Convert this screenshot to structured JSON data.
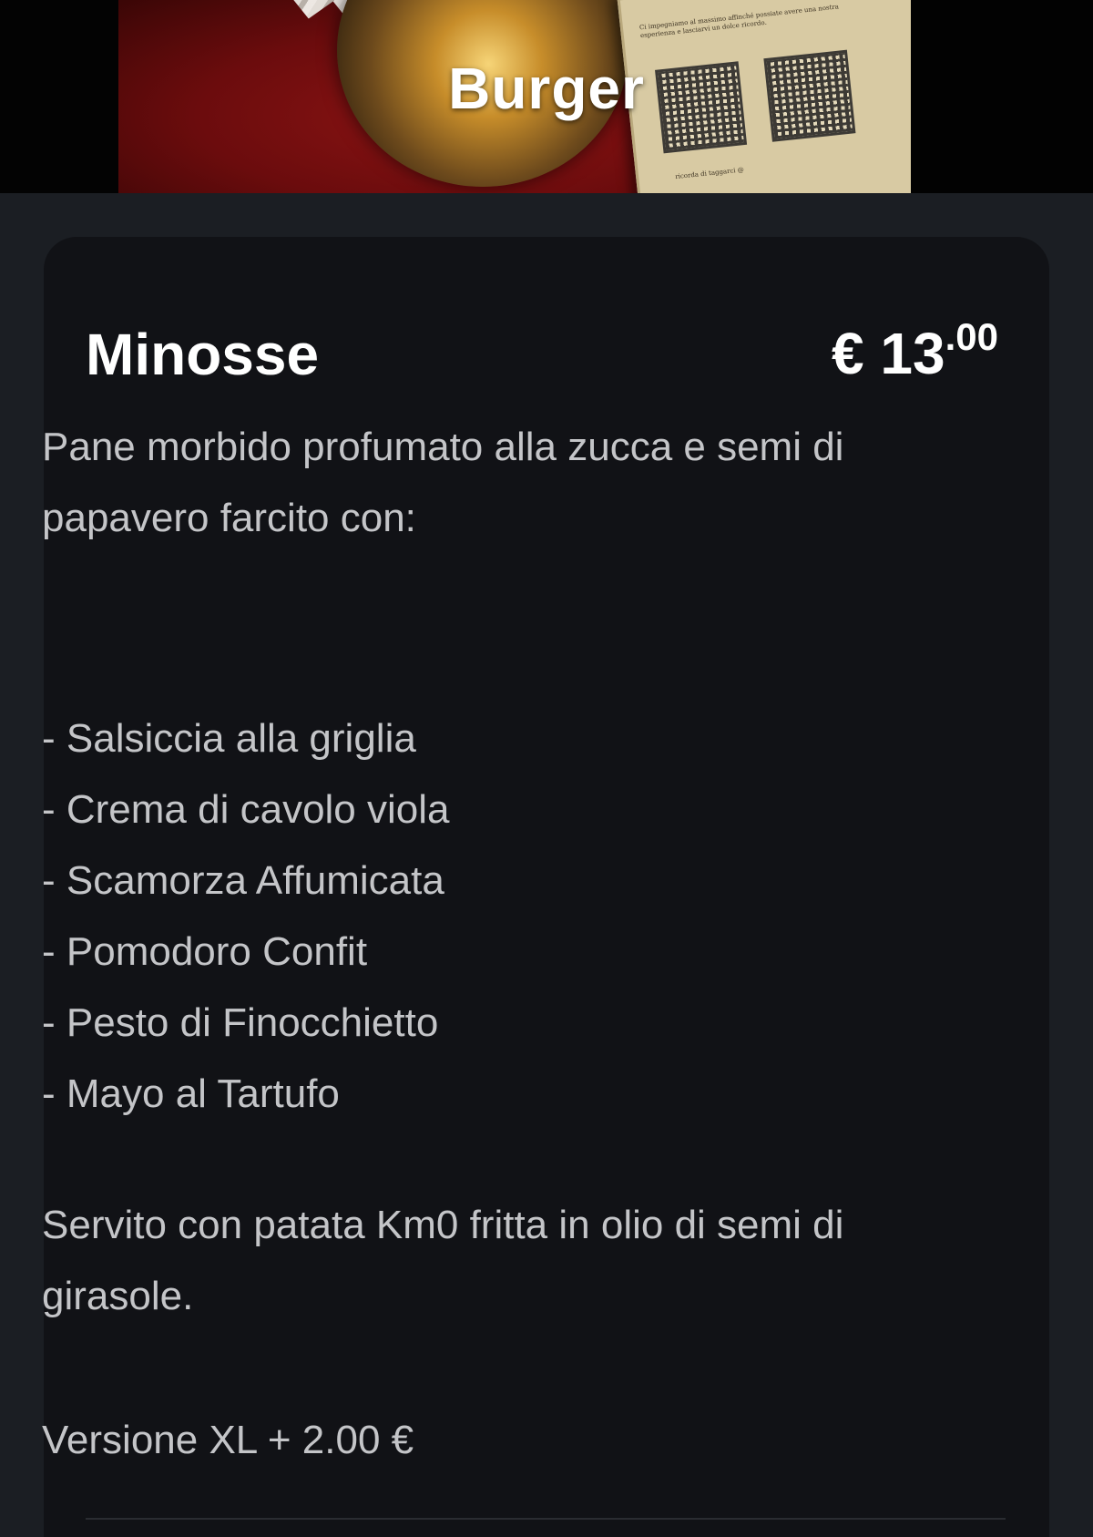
{
  "header": {
    "title": "Burger",
    "card_text": "Ci impegniamo al massimo affinché possiate avere una nostra esperienza e lasciarvi un dolce ricordo.",
    "card_footer": "ricorda di taggarci @"
  },
  "item": {
    "name": "Minosse",
    "price": {
      "main": "€ 13",
      "cents": ".00"
    },
    "intro": "Pane morbido profumato alla zucca e semi di papavero farcito con:",
    "ingredients": [
      "- Salsiccia alla griglia",
      "- Crema di cavolo viola",
      "- Scamorza Affumicata",
      "- Pomodoro Confit",
      "- Pesto di Finocchietto",
      "- Mayo al Tartufo"
    ],
    "served": "Servito con patata Km0 fritta in olio di semi di girasole.",
    "xl_option": "Versione XL + 2.00 €"
  },
  "colors": {
    "page_background": "#1b1e23",
    "card_background": "#111216",
    "title_text": "#ffffff",
    "body_text": "#c4c5c8"
  }
}
